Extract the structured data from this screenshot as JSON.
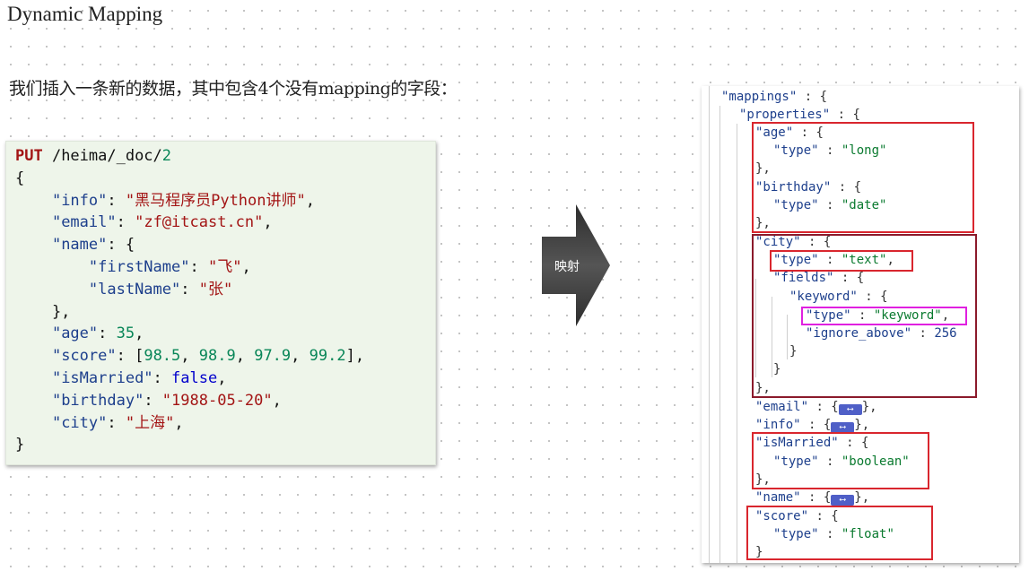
{
  "slide": {
    "title": "Dynamic Mapping",
    "intro": "我们插入一条新的数据，其中包含4个没有mapping的字段："
  },
  "request": {
    "method": "PUT",
    "path": " /heima/_doc/",
    "doc_id": "2",
    "fields": {
      "info": "\"黑马程序员Python讲师\"",
      "email": "\"zf@itcast.cn\"",
      "firstName": "\"飞\"",
      "lastName": "\"张\"",
      "age": "35",
      "score_values": [
        "98.5",
        "98.9",
        "97.9",
        "99.2"
      ],
      "isMarried": "false",
      "birthday": "\"1988-05-20\"",
      "city": "\"上海\""
    }
  },
  "arrow": {
    "label": "映射",
    "color": "#3a3a3a"
  },
  "mapping": {
    "mappings_key": "\"mappings\"",
    "properties_key": "\"properties\"",
    "age": {
      "key": "\"age\"",
      "type": "\"long\""
    },
    "birthday": {
      "key": "\"birthday\"",
      "type": "\"date\""
    },
    "city": {
      "key": "\"city\"",
      "type": "\"text\"",
      "fields_key": "\"fields\"",
      "keyword_key": "\"keyword\"",
      "keyword_type": "\"keyword\"",
      "ignore_above_key": "\"ignore_above\"",
      "ignore_above": "256"
    },
    "email": {
      "key": "\"email\""
    },
    "info": {
      "key": "\"info\""
    },
    "isMarried": {
      "key": "\"isMarried\"",
      "type": "\"boolean\""
    },
    "name": {
      "key": "\"name\""
    },
    "score": {
      "key": "\"score\"",
      "type": "\"float\""
    },
    "type_key": "\"type\"",
    "collapsed_icon": "collapsed-object-icon"
  },
  "colors": {
    "highlight_red": "#d9262e",
    "highlight_darkred": "#8b1a2b",
    "highlight_magenta": "#e020e0",
    "code_bg": "#eef5ea"
  }
}
